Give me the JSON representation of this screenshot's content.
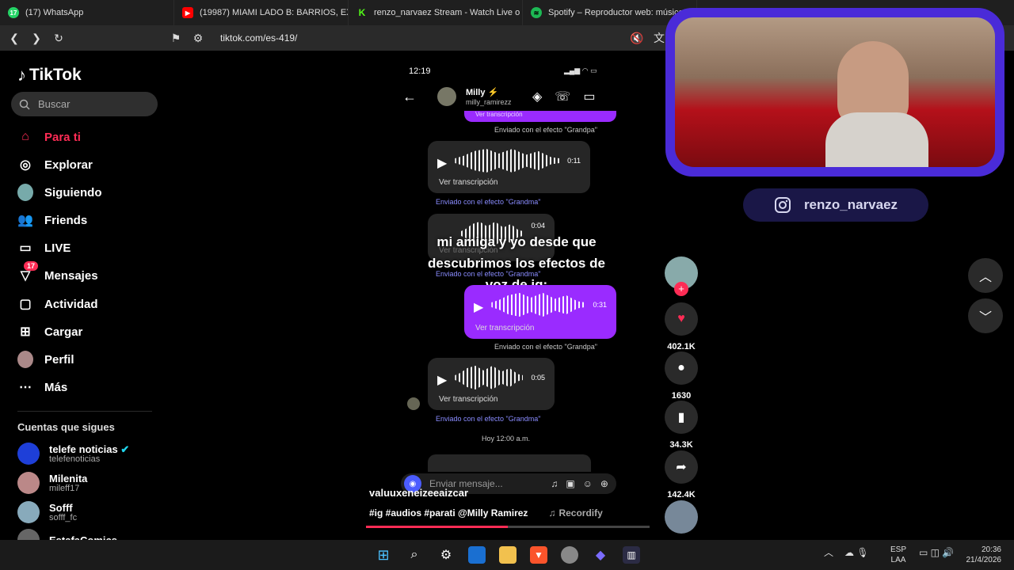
{
  "browser": {
    "tabs": [
      {
        "label": "(17) WhatsApp",
        "color": "#25d366",
        "glyph": "17"
      },
      {
        "label": "(19987) MIAMI LADO B: BARRIOS, EX",
        "color": "#ff0000",
        "glyph": "▶"
      },
      {
        "label": "renzo_narvaez Stream - Watch Live o",
        "color": "#53fc18",
        "glyph": "K"
      },
      {
        "label": "Spotify – Reproductor web: música",
        "color": "#1db954",
        "glyph": "≋"
      }
    ],
    "url": "tiktok.com/es-419/"
  },
  "sidebar": {
    "logo": "TikTok",
    "search_placeholder": "Buscar",
    "items": [
      {
        "label": "Para ti",
        "icon": "home-icon"
      },
      {
        "label": "Explorar",
        "icon": "compass-icon"
      },
      {
        "label": "Siguiendo",
        "icon": "following-icon"
      },
      {
        "label": "Friends",
        "icon": "friends-icon"
      },
      {
        "label": "LIVE",
        "icon": "live-icon"
      },
      {
        "label": "Mensajes",
        "icon": "messages-icon",
        "badge": "17"
      },
      {
        "label": "Actividad",
        "icon": "activity-icon"
      },
      {
        "label": "Cargar",
        "icon": "upload-icon"
      },
      {
        "label": "Perfil",
        "icon": "profile-icon"
      },
      {
        "label": "Más",
        "icon": "more-icon"
      }
    ],
    "following_title": "Cuentas que sigues",
    "accounts": [
      {
        "name": "telefe noticias",
        "handle": "telefenoticias"
      },
      {
        "name": "Milenita",
        "handle": "mileff17"
      },
      {
        "name": "Sofff",
        "handle": "sofff_fc"
      },
      {
        "name": "EstafaComics",
        "handle": ""
      }
    ]
  },
  "video": {
    "phone_time": "12:19",
    "chat_name": "Milly ⚡",
    "chat_handle": "milly_ramirezz",
    "messages": [
      {
        "duration": "0:11",
        "transcript": "Ver transcripción",
        "effect": "Enviado con el efecto \"Grandma\""
      },
      {
        "duration": "0:04",
        "transcript": "Ver transcripción",
        "effect": "Enviado con el efecto \"Grandma\""
      },
      {
        "duration": "0:31",
        "transcript": "Ver transcripción",
        "effect": "Enviado con el efecto \"Grandpa\""
      },
      {
        "duration": "0:05",
        "transcript": "Ver transcripción",
        "effect": "Enviado con el efecto \"Grandma\""
      }
    ],
    "top_partial_transcript": "Ver transcripción",
    "top_effect": "Enviado con el efecto \"Grandpa\"",
    "time_label": "Hoy 12:00 a.m.",
    "compose_placeholder": "Enviar mensaje...",
    "caption": "mi amiga y yo desde que descubrimos los efectos de voz de ig:",
    "author": "valuuxeneizeeaizcar",
    "description": "#ig #audios #parati @Milly Ramirez",
    "music": "Recordify",
    "progress": 0.5
  },
  "actions": {
    "likes": "402.1K",
    "comments": "1630",
    "saves": "34.3K",
    "shares": "142.4K"
  },
  "overlay": {
    "instagram_handle": "renzo_narvaez"
  },
  "taskbar": {
    "lang_top": "ESP",
    "lang_bottom": "LAA",
    "time": "20:36",
    "date": "21/4/2026"
  }
}
